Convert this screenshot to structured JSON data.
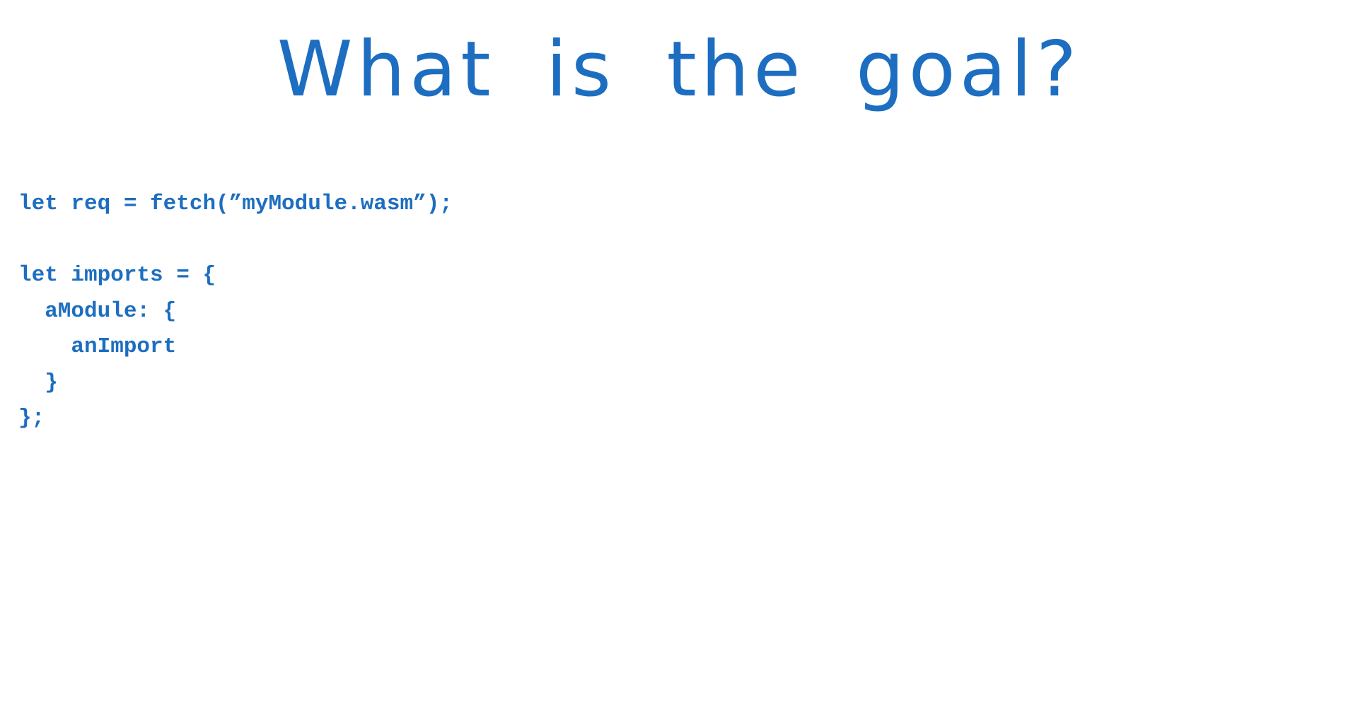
{
  "slide": {
    "title": "What is the goal?",
    "code_lines": [
      "let req = fetch(”myModule.wasm”);",
      "",
      "let imports = {",
      "  aModule: {",
      "    anImport",
      "  }",
      "};"
    ]
  },
  "colors": {
    "text": "#1d6ec0",
    "background": "#ffffff"
  }
}
